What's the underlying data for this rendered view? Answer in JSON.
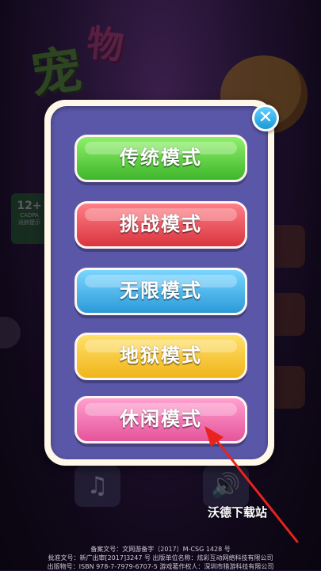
{
  "background": {
    "logo_chars": [
      "宠",
      "物"
    ],
    "age_rating": "12+",
    "age_sub": "CADPA",
    "age_caption": "适龄提示"
  },
  "dialog": {
    "close_label": "✕",
    "modes": [
      {
        "label": "传统模式",
        "color": "#5cd43f"
      },
      {
        "label": "挑战模式",
        "color": "#e84a52"
      },
      {
        "label": "无限模式",
        "color": "#3fb0e8"
      },
      {
        "label": "地狱模式",
        "color": "#f5c52a"
      },
      {
        "label": "休闲模式",
        "color": "#ef72b2"
      }
    ]
  },
  "bottom_icons": [
    "music-note-icon",
    "speaker-icon"
  ],
  "watermark": "沃德下载站",
  "footer": {
    "line1": "备案文号：文网游备字〔2017〕M-CSG 1428 号",
    "line2": "批准文号：新广出审[2017]3247 号  出版单位名称：炫彩互动网络科技有限公司",
    "line3": "出版物号：ISBN 978-7-7979-6707-5  游戏著作权人：深圳市猎游科技有限公司"
  }
}
